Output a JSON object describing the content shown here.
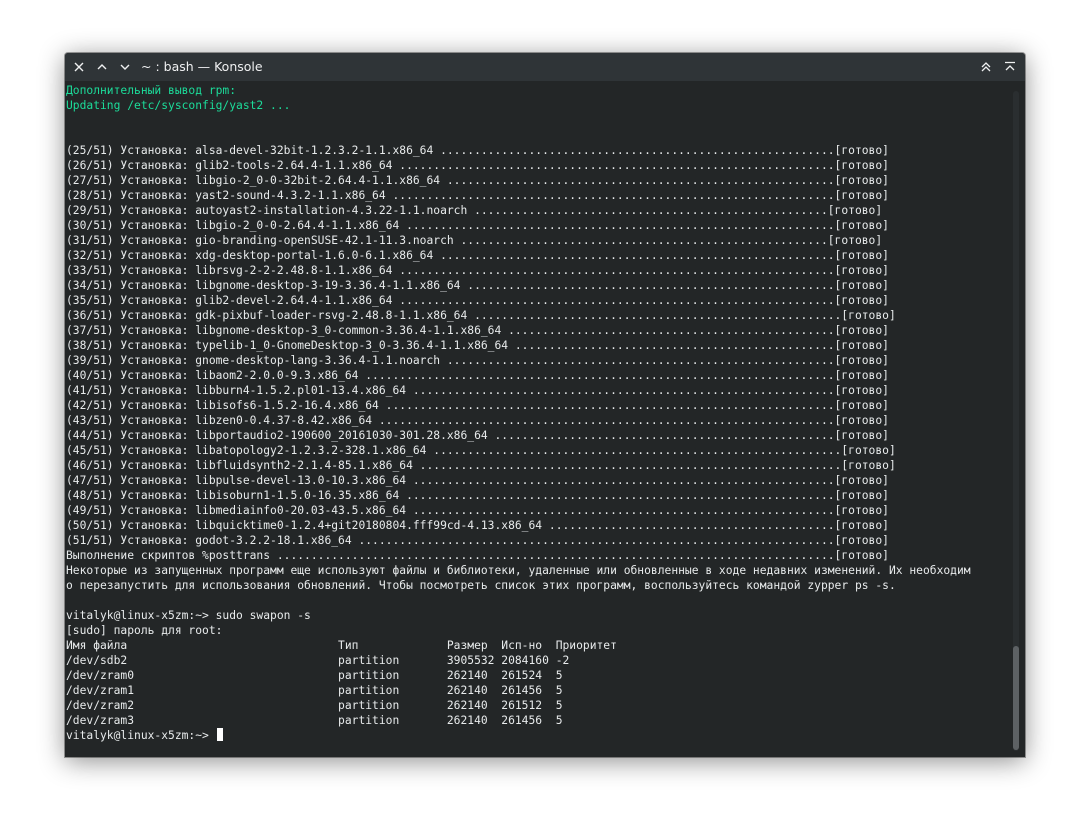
{
  "window": {
    "title": "~ : bash — Konsole",
    "buttons": {
      "close": "close-icon",
      "shade_up": "chevron-up-icon",
      "shade_down": "chevron-down-icon",
      "keep_above": "keep-above-icon",
      "maximize": "maximize-icon"
    }
  },
  "colors": {
    "terminal_bg": "#232627",
    "text": "#e8ebec",
    "green_text": "#1cdc9a",
    "titlebar": "#2f3437"
  },
  "terminal": {
    "lines": [
      {
        "text": "Дополнительный вывод rpm:",
        "style": "green"
      },
      {
        "text": "Updating /etc/sysconfig/yast2 ...",
        "style": "green"
      },
      {
        "text": "",
        "style": "normal"
      },
      {
        "text": "",
        "style": "normal"
      },
      {
        "text": "(25/51) Установка: alsa-devel-32bit-1.2.3.2-1.1.x86_64 ..........................................................[готово]",
        "style": "normal"
      },
      {
        "text": "(26/51) Установка: glib2-tools-2.64.4-1.1.x86_64 ................................................................[готово]",
        "style": "normal"
      },
      {
        "text": "(27/51) Установка: libgio-2_0-0-32bit-2.64.4-1.1.x86_64 .........................................................[готово]",
        "style": "normal"
      },
      {
        "text": "(28/51) Установка: yast2-sound-4.3.2-1.1.x86_64 .................................................................[готово]",
        "style": "normal"
      },
      {
        "text": "(29/51) Установка: autoyast2-installation-4.3.22-1.1.noarch ....................................................[готово]",
        "style": "normal"
      },
      {
        "text": "(30/51) Установка: libgio-2_0-0-2.64.4-1.1.x86_64 ...............................................................[готово]",
        "style": "normal"
      },
      {
        "text": "(31/51) Установка: gio-branding-openSUSE-42.1-11.3.noarch ......................................................[готово]",
        "style": "normal"
      },
      {
        "text": "(32/51) Установка: xdg-desktop-portal-1.6.0-6.1.x86_64 ..........................................................[готово]",
        "style": "normal"
      },
      {
        "text": "(33/51) Установка: librsvg-2-2-2.48.8-1.1.x86_64 ................................................................[готово]",
        "style": "normal"
      },
      {
        "text": "(34/51) Установка: libgnome-desktop-3-19-3.36.4-1.1.x86_64 ......................................................[готово]",
        "style": "normal"
      },
      {
        "text": "(35/51) Установка: glib2-devel-2.64.4-1.1.x86_64 ................................................................[готово]",
        "style": "normal"
      },
      {
        "text": "(36/51) Установка: gdk-pixbuf-loader-rsvg-2.48.8-1.1.x86_64 ......................................................[готово]",
        "style": "normal"
      },
      {
        "text": "(37/51) Установка: libgnome-desktop-3_0-common-3.36.4-1.1.x86_64 ................................................[готово]",
        "style": "normal"
      },
      {
        "text": "(38/51) Установка: typelib-1_0-GnomeDesktop-3_0-3.36.4-1.1.x86_64 ...............................................[готово]",
        "style": "normal"
      },
      {
        "text": "(39/51) Установка: gnome-desktop-lang-3.36.4-1.1.noarch .........................................................[готово]",
        "style": "normal"
      },
      {
        "text": "(40/51) Установка: libaom2-2.0.0-9.3.x86_64 .....................................................................[готово]",
        "style": "normal"
      },
      {
        "text": "(41/51) Установка: libburn4-1.5.2.pl01-13.4.x86_64 ..............................................................[готово]",
        "style": "normal"
      },
      {
        "text": "(42/51) Установка: libisofs6-1.5.2-16.4.x86_64 ..................................................................[готово]",
        "style": "normal"
      },
      {
        "text": "(43/51) Установка: libzen0-0.4.37-8.42.x86_64 ...................................................................[готово]",
        "style": "normal"
      },
      {
        "text": "(44/51) Установка: libportaudio2-190600_20161030-301.28.x86_64 ..................................................[готово]",
        "style": "normal"
      },
      {
        "text": "(45/51) Установка: libatopology2-1.2.3.2-328.1.x86_64 ............................................................[готово]",
        "style": "normal"
      },
      {
        "text": "(46/51) Установка: libfluidsynth2-2.1.4-85.1.x86_64 ..............................................................[готово]",
        "style": "normal"
      },
      {
        "text": "(47/51) Установка: libpulse-devel-13.0-10.3.x86_64 ..............................................................[готово]",
        "style": "normal"
      },
      {
        "text": "(48/51) Установка: libisoburn1-1.5.0-16.35.x86_64 ...............................................................[готово]",
        "style": "normal"
      },
      {
        "text": "(49/51) Установка: libmediainfo0-20.03-43.5.x86_64 ..............................................................[готово]",
        "style": "normal"
      },
      {
        "text": "(50/51) Установка: libquicktime0-1.2.4+git20180804.fff99cd-4.13.x86_64 ..........................................[готово]",
        "style": "normal"
      },
      {
        "text": "(51/51) Установка: godot-3.2.2-18.1.x86_64 ......................................................................[готово]",
        "style": "normal"
      },
      {
        "text": "Выполнение скриптов %posttrans ..................................................................................[готово]",
        "style": "normal"
      },
      {
        "text": "Некоторые из запущенных программ еще используют файлы и библиотеки, удаленные или обновленные в ходе недавних изменений. Их необходим",
        "style": "normal"
      },
      {
        "text": "о перезапустить для использования обновлений. Чтобы посмотреть список этих программ, воспользуйтесь командой zypper ps -s.",
        "style": "normal"
      },
      {
        "text": "",
        "style": "normal"
      },
      {
        "text": "vitalyk@linux-x5zm:~> sudo swapon -s",
        "style": "normal"
      },
      {
        "text": "[sudo] пароль для root:",
        "style": "normal"
      },
      {
        "text": "Имя файла                               Тип             Размер  Исп-но  Приоритет",
        "style": "normal"
      },
      {
        "text": "/dev/sdb2                               partition       3905532 2084160 -2",
        "style": "normal"
      },
      {
        "text": "/dev/zram0                              partition       262140  261524  5",
        "style": "normal"
      },
      {
        "text": "/dev/zram1                              partition       262140  261456  5",
        "style": "normal"
      },
      {
        "text": "/dev/zram2                              partition       262140  261512  5",
        "style": "normal"
      },
      {
        "text": "/dev/zram3                              partition       262140  261456  5",
        "style": "normal"
      }
    ],
    "prompt": "vitalyk@linux-x5zm:~> "
  }
}
